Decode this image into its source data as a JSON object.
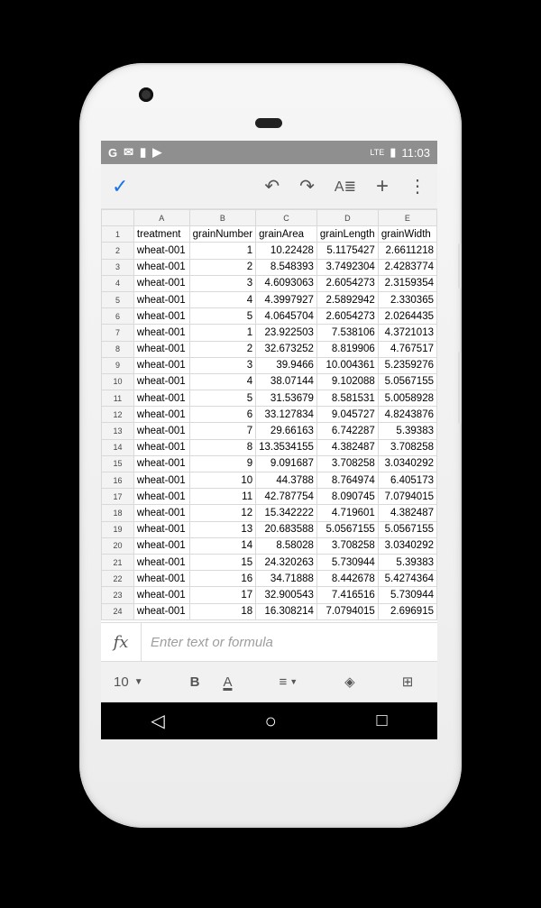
{
  "status": {
    "time": "11:03",
    "left_icons": [
      "G",
      "✉",
      "▮",
      "▶"
    ],
    "right_icons": [
      "LTE",
      "▮"
    ]
  },
  "toolbar": {
    "check": "✓",
    "undo": "↶",
    "redo": "↷",
    "format": "A≣",
    "add": "+",
    "more": "⋮"
  },
  "columns": [
    "A",
    "B",
    "C",
    "D",
    "E"
  ],
  "rows": [
    [
      "1",
      "treatment",
      "grainNumber",
      "grainArea",
      "grainLength",
      "grainWidth"
    ],
    [
      "2",
      "wheat-001",
      "1",
      "10.22428",
      "5.1175427",
      "2.6611218"
    ],
    [
      "3",
      "wheat-001",
      "2",
      "8.548393",
      "3.7492304",
      "2.4283774"
    ],
    [
      "4",
      "wheat-001",
      "3",
      "4.6093063",
      "2.6054273",
      "2.3159354"
    ],
    [
      "5",
      "wheat-001",
      "4",
      "4.3997927",
      "2.5892942",
      "2.330365"
    ],
    [
      "6",
      "wheat-001",
      "5",
      "4.0645704",
      "2.6054273",
      "2.0264435"
    ],
    [
      "7",
      "wheat-001",
      "1",
      "23.922503",
      "7.538106",
      "4.3721013"
    ],
    [
      "8",
      "wheat-001",
      "2",
      "32.673252",
      "8.819906",
      "4.767517"
    ],
    [
      "9",
      "wheat-001",
      "3",
      "39.9466",
      "10.004361",
      "5.2359276"
    ],
    [
      "10",
      "wheat-001",
      "4",
      "38.07144",
      "9.102088",
      "5.0567155"
    ],
    [
      "11",
      "wheat-001",
      "5",
      "31.53679",
      "8.581531",
      "5.0058928"
    ],
    [
      "12",
      "wheat-001",
      "6",
      "33.127834",
      "9.045727",
      "4.8243876"
    ],
    [
      "13",
      "wheat-001",
      "7",
      "29.66163",
      "6.742287",
      "5.39383"
    ],
    [
      "14",
      "wheat-001",
      "8",
      "13.3534155",
      "4.382487",
      "3.708258"
    ],
    [
      "15",
      "wheat-001",
      "9",
      "9.091687",
      "3.708258",
      "3.0340292"
    ],
    [
      "16",
      "wheat-001",
      "10",
      "44.3788",
      "8.764974",
      "6.405173"
    ],
    [
      "17",
      "wheat-001",
      "11",
      "42.787754",
      "8.090745",
      "7.0794015"
    ],
    [
      "18",
      "wheat-001",
      "12",
      "15.342222",
      "4.719601",
      "4.382487"
    ],
    [
      "19",
      "wheat-001",
      "13",
      "20.683588",
      "5.0567155",
      "5.0567155"
    ],
    [
      "20",
      "wheat-001",
      "14",
      "8.58028",
      "3.708258",
      "3.0340292"
    ],
    [
      "21",
      "wheat-001",
      "15",
      "24.320263",
      "5.730944",
      "5.39383"
    ],
    [
      "22",
      "wheat-001",
      "16",
      "34.71888",
      "8.442678",
      "5.4274364"
    ],
    [
      "23",
      "wheat-001",
      "17",
      "32.900543",
      "7.416516",
      "5.730944"
    ],
    [
      "24",
      "wheat-001",
      "18",
      "16.308214",
      "7.0794015",
      "2.696915"
    ]
  ],
  "formula": {
    "fx": "fx",
    "placeholder": "Enter text or formula"
  },
  "format": {
    "font_size": "10",
    "bold": "B",
    "text_color": "A"
  },
  "nav": {
    "back": "◁",
    "home": "○",
    "recents": "□"
  },
  "colors": {
    "accent": "#1a73e8",
    "statusbar": "#8f8f8f"
  }
}
